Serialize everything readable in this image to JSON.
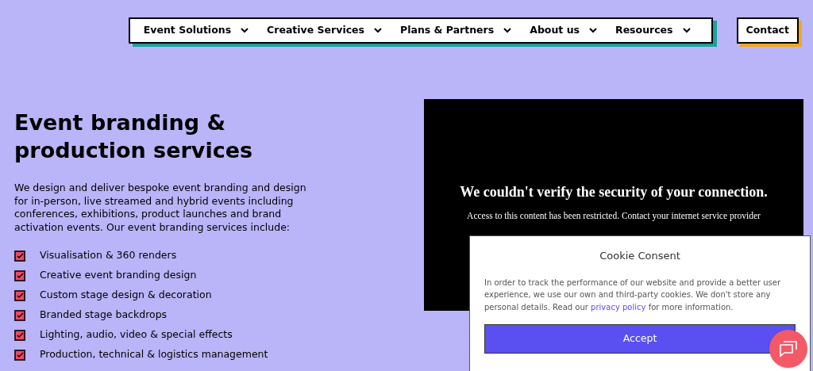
{
  "nav": {
    "items": [
      {
        "label": "Event Solutions"
      },
      {
        "label": "Creative Services"
      },
      {
        "label": "Plans & Partners"
      },
      {
        "label": "About us"
      },
      {
        "label": "Resources"
      }
    ],
    "contact": "Contact"
  },
  "hero": {
    "title": "Event branding & production services",
    "intro": "We design and deliver bespoke event branding and design for in-person, live streamed and hybrid events including conferences, exhibitions, product launches and brand activation events. Our event branding services include:",
    "services": [
      {
        "label": "Visualisation & 360 renders",
        "checked": true
      },
      {
        "label": "Creative event branding design",
        "checked": true
      },
      {
        "label": "Custom stage design & decoration",
        "checked": true
      },
      {
        "label": "Branded stage backdrops",
        "checked": true
      },
      {
        "label": "Lighting, audio, video & special effects",
        "checked": true
      },
      {
        "label": "Production, technical & logistics management",
        "checked": true
      }
    ]
  },
  "embed": {
    "heading": "We couldn't verify the security of your connection.",
    "message": "Access to this content has been restricted. Contact your internet service provider"
  },
  "cookie": {
    "title": "Cookie Consent",
    "text_before": "In order to track the performance of our website and provide a better user experience, we use our own and third-party cookies. We don't store any personal details. Read our",
    "link": "privacy policy",
    "text_after": "for more information.",
    "button": "Accept"
  }
}
